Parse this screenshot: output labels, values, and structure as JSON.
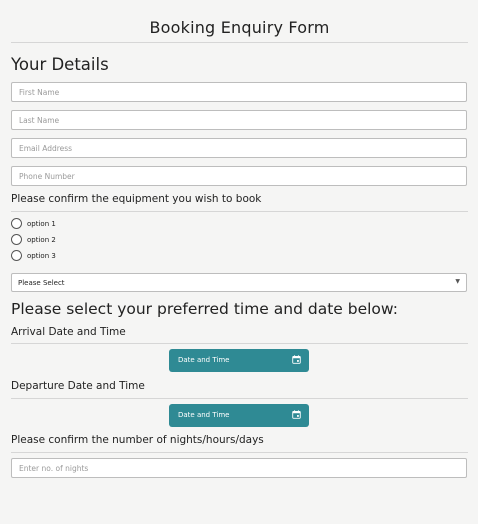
{
  "form": {
    "title": "Booking Enquiry Form"
  },
  "details": {
    "heading": "Your Details",
    "first_name_placeholder": "First Name",
    "last_name_placeholder": "Last Name",
    "email_placeholder": "Email Address",
    "phone_placeholder": "Phone Number"
  },
  "equipment": {
    "question": "Please confirm the equipment you wish to book",
    "options": [
      "option 1",
      "option 2",
      "option 3"
    ],
    "select_value": "Please Select"
  },
  "schedule": {
    "heading": "Please select your preferred time and date below:",
    "arrival_label": "Arrival Date and Time",
    "arrival_button": "Date and Time",
    "departure_label": "Departure Date and Time",
    "departure_button": "Date and Time",
    "nights_question": "Please confirm the number of nights/hours/days",
    "nights_placeholder": "Enter no. of nights"
  },
  "colors": {
    "accent": "#2f8a94",
    "background": "#f5f5f4",
    "border": "#bdbdbd"
  },
  "icons": {
    "calendar": "calendar-icon",
    "dropdown": "chevron-down-icon",
    "radio": "radio-icon"
  }
}
